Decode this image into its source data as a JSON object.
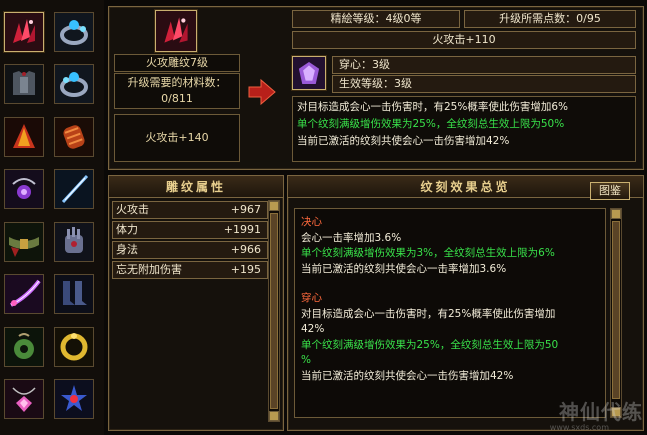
{
  "item": {
    "name": "火攻雕纹7级",
    "materials_label": "升级需要的材料数：",
    "materials_value": "0/811",
    "stat": "火攻击+140"
  },
  "upgrade": {
    "refine_level": "精絵等级：4级0等",
    "points_needed": "升级所需点数：0/95",
    "stat": "火攻击+110",
    "gem_name": "穿心：3级",
    "effect_level": "生效等级：3级",
    "desc": [
      {
        "text": "对目标造成会心一击伤害时，有25%概率使此伤害增加6%",
        "color": "white"
      },
      {
        "text": "单个纹刻满级增伤效果为25%，全纹刻总生效上限为50%",
        "color": "green"
      },
      {
        "text": "当前已激活的纹刻共使会心一击伤害增加42%",
        "color": "white"
      }
    ]
  },
  "attributes": {
    "title": "雕纹属性",
    "rows": [
      {
        "name": "火攻击",
        "value": "+967"
      },
      {
        "name": "体力",
        "value": "+1991"
      },
      {
        "name": "身法",
        "value": "+966"
      },
      {
        "name": "忘无附加伤害",
        "value": "+195"
      }
    ]
  },
  "effects": {
    "title": "纹刻效果总览",
    "button": "图鉴",
    "sections": [
      {
        "name": "决心",
        "lines": [
          {
            "text": "会心一击率增加3.6%",
            "color": "white"
          },
          {
            "text": "单个纹刻满级增伤效果为3%，全纹刻总生效上限为6%",
            "color": "green"
          },
          {
            "text": "当前已激活的纹刻共使会心一击率增加3.6%",
            "color": "white"
          }
        ]
      },
      {
        "name": "穿心",
        "lines": [
          {
            "text": "对目标造成会心一击伤害时，有25%概率使此伤害增加",
            "color": "white"
          },
          {
            "text": "42%",
            "color": "white"
          },
          {
            "text": "单个纹刻满级增伤效果为25%，全纹刻总生效上限为50",
            "color": "green"
          },
          {
            "text": "%",
            "color": "green"
          },
          {
            "text": "当前已激活的纹刻共使会心一击伤害增加42%",
            "color": "white"
          }
        ]
      }
    ]
  },
  "equipment": [
    {
      "icon": "crystal-cluster-icon"
    },
    {
      "icon": "gem-ring-icon"
    },
    {
      "icon": "armor-icon"
    },
    {
      "icon": "gem-ring-icon"
    },
    {
      "icon": "cape-icon"
    },
    {
      "icon": "bracer-icon"
    },
    {
      "icon": "amulet-icon"
    },
    {
      "icon": "needle-icon"
    },
    {
      "icon": "belt-icon"
    },
    {
      "icon": "gauntlet-icon"
    },
    {
      "icon": "blade-icon"
    },
    {
      "icon": "boots-icon"
    },
    {
      "icon": "jade-pendant-icon"
    },
    {
      "icon": "gold-ring-icon"
    },
    {
      "icon": "pink-gem-necklace-icon"
    },
    {
      "icon": "star-brooch-icon"
    }
  ],
  "colors": {
    "gold": "#e8cf8e",
    "green": "#39e24a",
    "red": "#ff6a3d",
    "border": "#7a6540"
  },
  "watermark": {
    "text": "神仙代练",
    "url": "www.sxds.com"
  }
}
